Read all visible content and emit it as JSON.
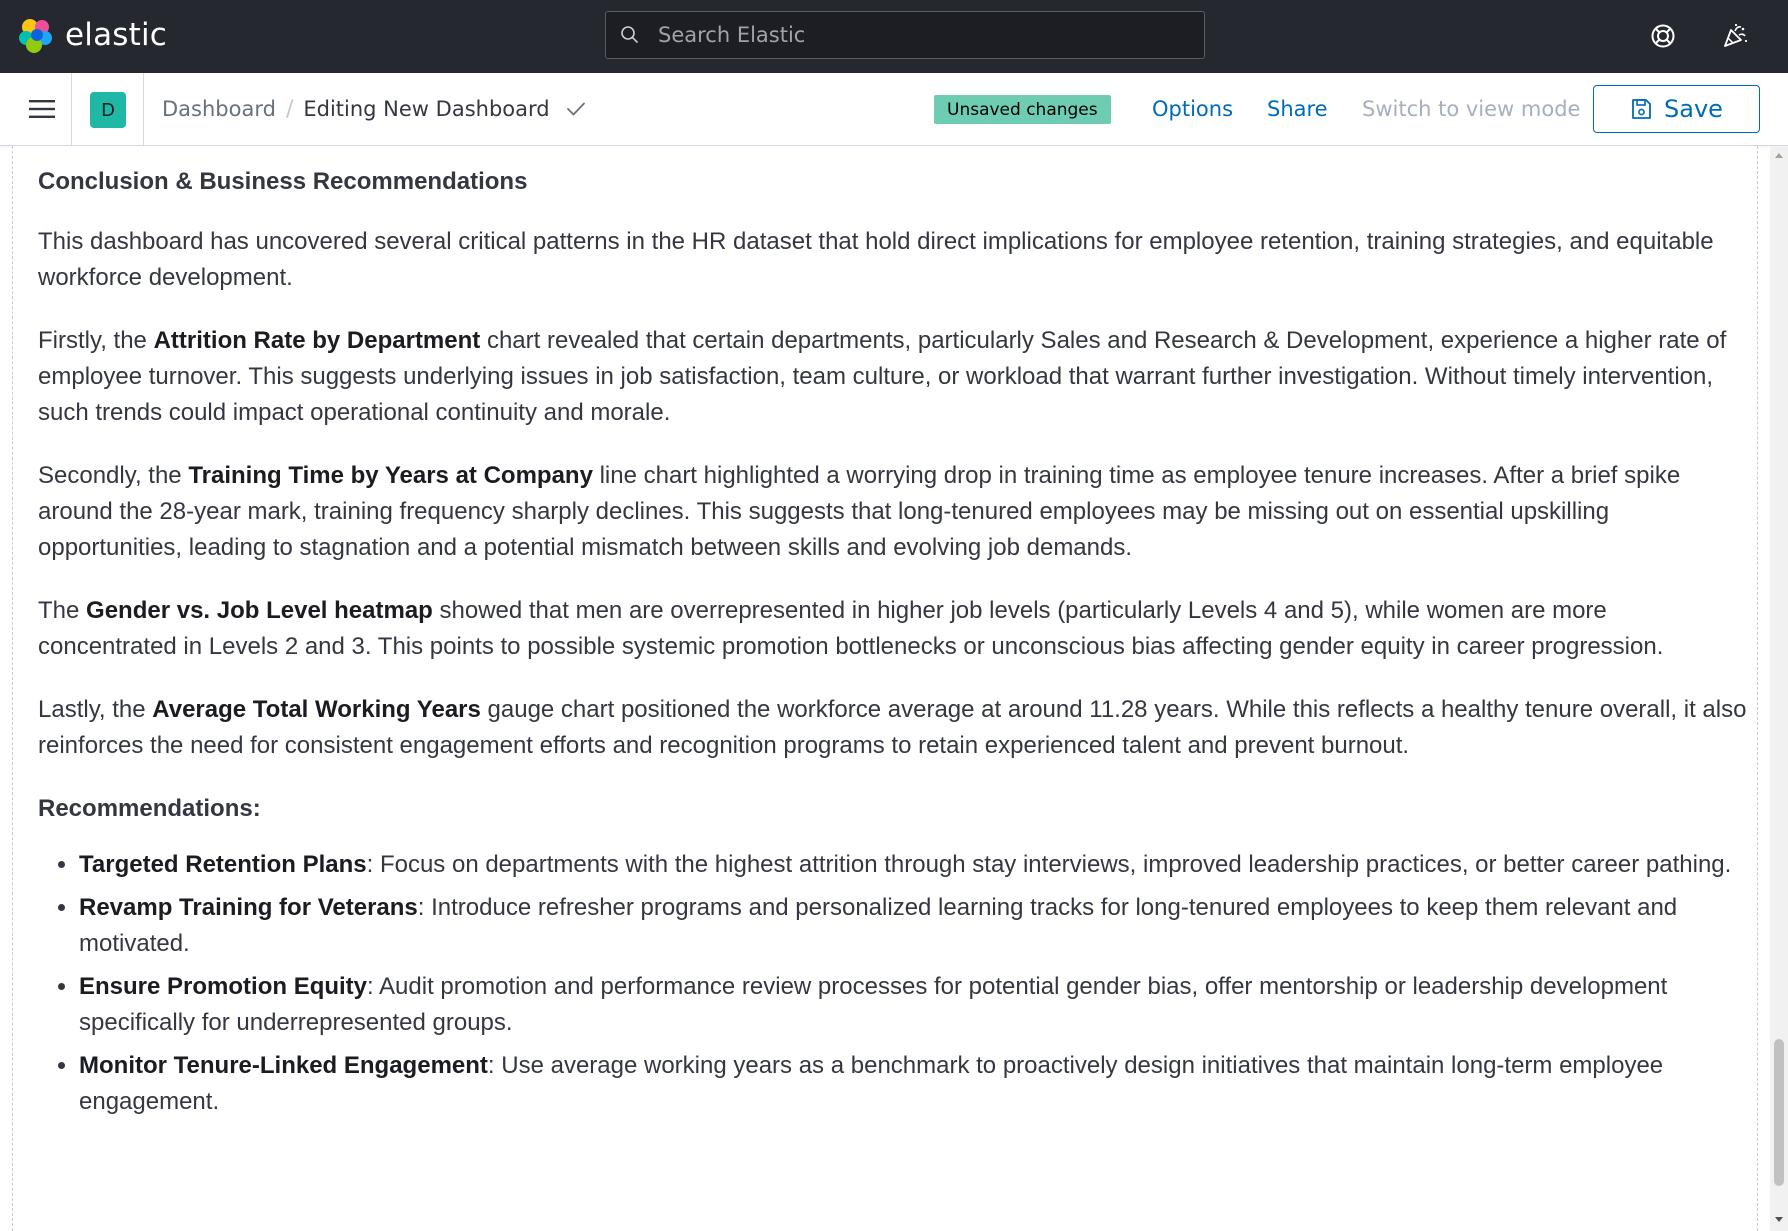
{
  "header": {
    "brand": "elastic",
    "search_placeholder": "Search Elastic",
    "help_icon": "lifebuoy-icon",
    "news_icon": "party-popper-icon"
  },
  "subheader": {
    "space_initial": "D",
    "breadcrumbs": [
      {
        "label": "Dashboard",
        "link": true
      },
      {
        "label": "Editing New Dashboard",
        "link": false
      }
    ],
    "unsaved_badge": "Unsaved changes",
    "options_label": "Options",
    "share_label": "Share",
    "view_mode_label": "Switch to view mode",
    "save_label": "Save"
  },
  "content": {
    "heading": "Conclusion & Business Recommendations",
    "intro": "This dashboard has uncovered several critical patterns in the HR dataset that hold direct implications for employee retention, training strategies, and equitable workforce development.",
    "paragraphs": [
      {
        "pre": "Firstly, the ",
        "bold": "Attrition Rate by Department",
        "post": " chart revealed that certain departments, particularly Sales and Research & Development, experience a higher rate of employee turnover. This suggests underlying issues in job satisfaction, team culture, or workload that warrant further investigation. Without timely intervention, such trends could impact operational continuity and morale."
      },
      {
        "pre": "Secondly, the ",
        "bold": "Training Time by Years at Company",
        "post": " line chart highlighted a worrying drop in training time as employee tenure increases. After a brief spike around the 28-year mark, training frequency sharply declines. This suggests that long-tenured employees may be missing out on essential upskilling opportunities, leading to stagnation and a potential mismatch between skills and evolving job demands."
      },
      {
        "pre": "The ",
        "bold": "Gender vs. Job Level heatmap",
        "post": " showed that men are overrepresented in higher job levels (particularly Levels 4 and 5), while women are more concentrated in Levels 2 and 3. This points to possible systemic promotion bottlenecks or unconscious bias affecting gender equity in career progression."
      },
      {
        "pre": "Lastly, the ",
        "bold": "Average Total Working Years",
        "post": " gauge chart positioned the workforce average at around 11.28 years. While this reflects a healthy tenure overall, it also reinforces the need for consistent engagement efforts and recognition programs to retain experienced talent and prevent burnout."
      }
    ],
    "recommendations_heading": "Recommendations:",
    "recommendations": [
      {
        "title": "Targeted Retention Plans",
        "text": ": Focus on departments with the highest attrition through stay interviews, improved leadership practices, or better career pathing."
      },
      {
        "title": "Revamp Training for Veterans",
        "text": ": Introduce refresher programs and personalized learning tracks for long-tenured employees to keep them relevant and motivated."
      },
      {
        "title": "Ensure Promotion Equity",
        "text": ": Audit promotion and performance review processes for potential gender bias, offer mentorship or leadership development specifically for underrepresented groups."
      },
      {
        "title": "Monitor Tenure-Linked Engagement",
        "text": ": Use average working years as a benchmark to proactively design initiatives that maintain long-term employee engagement."
      }
    ]
  },
  "colors": {
    "header_bg": "#25282f",
    "accent": "#006bb8",
    "badge_bg": "#6dccb1",
    "space_avatar": "#1fb8a5"
  }
}
